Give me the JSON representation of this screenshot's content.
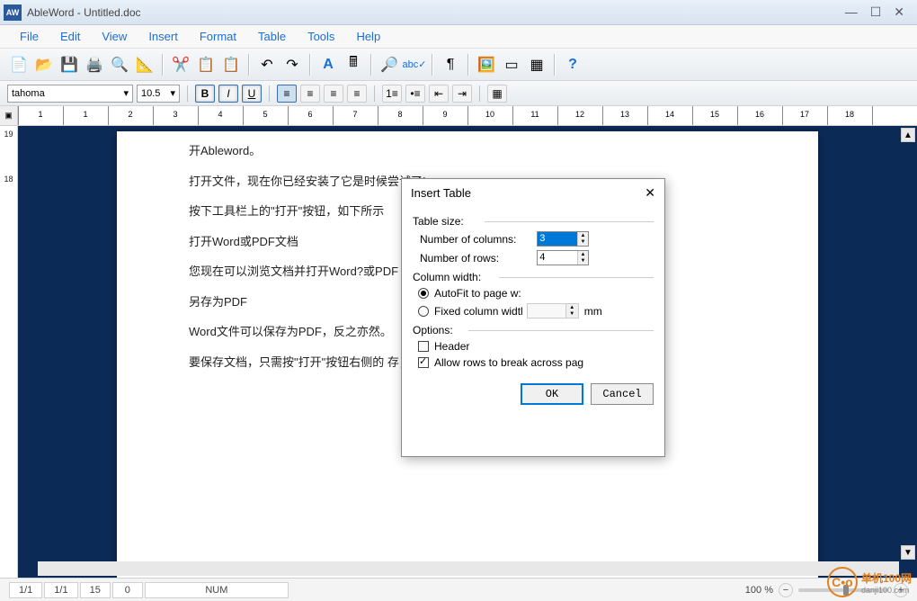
{
  "window": {
    "app_icon_text": "AW",
    "title": "AbleWord - Untitled.doc"
  },
  "menubar": [
    "File",
    "Edit",
    "View",
    "Insert",
    "Format",
    "Table",
    "Tools",
    "Help"
  ],
  "formatbar": {
    "font": "tahoma",
    "size": "10.5"
  },
  "document_lines": [
    "开Ableword。",
    "打开文件，现在你已经安装了它是时候尝试了!",
    "按下工具栏上的\"打开\"按钮，如下所示",
    "打开Word或PDF文档",
    "您现在可以浏览文档并打开Word?或PDF                                                                入图像或表格。",
    "另存为PDF",
    "Word文件可以保存为PDF，反之亦然。",
    "要保存文档，只需按\"打开\"按钮右侧的                                                                        存，如下所示。"
  ],
  "ruler_h": [
    "1",
    "1",
    "2",
    "3",
    "4",
    "5",
    "6",
    "7",
    "8",
    "9",
    "10",
    "11",
    "12",
    "13",
    "14",
    "15",
    "16",
    "17",
    "18"
  ],
  "ruler_v": [
    "19",
    "18"
  ],
  "dialog": {
    "title": "Insert Table",
    "table_size_label": "Table size:",
    "cols_label": "Number of columns:",
    "cols_value": "3",
    "rows_label": "Number of rows:",
    "rows_value": "4",
    "col_width_label": "Column width:",
    "autofit_label": "AutoFit to page w:",
    "fixed_label": "Fixed column widtl",
    "unit": "mm",
    "options_label": "Options:",
    "header_label": "Header",
    "allow_break_label": "Allow rows to break across pag",
    "ok": "OK",
    "cancel": "Cancel",
    "close_glyph": "✕"
  },
  "statusbar": {
    "page": "1/1",
    "section": "1/1",
    "line": "15",
    "col": "0",
    "mode": "NUM",
    "zoom": "100 %"
  },
  "watermark": {
    "logo_text": "C•o",
    "main": "单机100网",
    "sub": "danji100.com"
  }
}
